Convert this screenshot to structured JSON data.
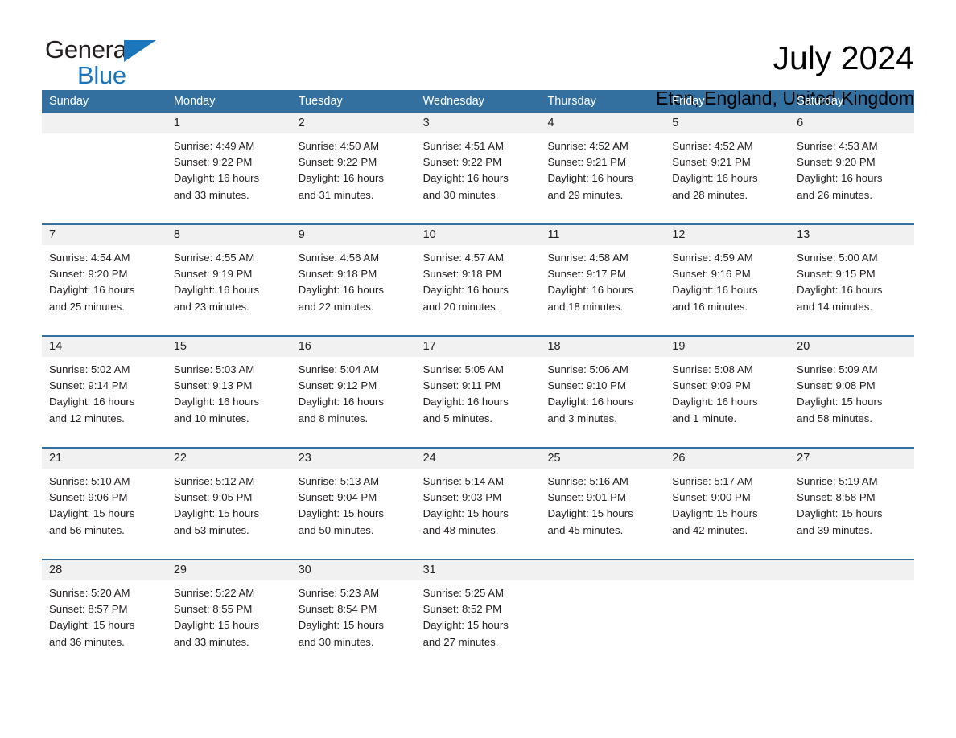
{
  "brand": {
    "name_part1": "General",
    "name_part2": "Blue",
    "color_primary": "#1b76bc",
    "triangle_icon": "triangle-icon"
  },
  "header": {
    "title": "July 2024",
    "subtitle": "Eton, England, United Kingdom"
  },
  "colors": {
    "header_row_bg": "#34709f",
    "date_band_bg": "#f1f1f1",
    "row_divider": "#34709f",
    "text": "#231f20",
    "brand_blue": "#1b76bc"
  },
  "calendar": {
    "day_names": [
      "Sunday",
      "Monday",
      "Tuesday",
      "Wednesday",
      "Thursday",
      "Friday",
      "Saturday"
    ],
    "weeks": [
      [
        {
          "day": "",
          "lines": []
        },
        {
          "day": "1",
          "lines": [
            "Sunrise: 4:49 AM",
            "Sunset: 9:22 PM",
            "Daylight: 16 hours",
            "and 33 minutes."
          ]
        },
        {
          "day": "2",
          "lines": [
            "Sunrise: 4:50 AM",
            "Sunset: 9:22 PM",
            "Daylight: 16 hours",
            "and 31 minutes."
          ]
        },
        {
          "day": "3",
          "lines": [
            "Sunrise: 4:51 AM",
            "Sunset: 9:22 PM",
            "Daylight: 16 hours",
            "and 30 minutes."
          ]
        },
        {
          "day": "4",
          "lines": [
            "Sunrise: 4:52 AM",
            "Sunset: 9:21 PM",
            "Daylight: 16 hours",
            "and 29 minutes."
          ]
        },
        {
          "day": "5",
          "lines": [
            "Sunrise: 4:52 AM",
            "Sunset: 9:21 PM",
            "Daylight: 16 hours",
            "and 28 minutes."
          ]
        },
        {
          "day": "6",
          "lines": [
            "Sunrise: 4:53 AM",
            "Sunset: 9:20 PM",
            "Daylight: 16 hours",
            "and 26 minutes."
          ]
        }
      ],
      [
        {
          "day": "7",
          "lines": [
            "Sunrise: 4:54 AM",
            "Sunset: 9:20 PM",
            "Daylight: 16 hours",
            "and 25 minutes."
          ]
        },
        {
          "day": "8",
          "lines": [
            "Sunrise: 4:55 AM",
            "Sunset: 9:19 PM",
            "Daylight: 16 hours",
            "and 23 minutes."
          ]
        },
        {
          "day": "9",
          "lines": [
            "Sunrise: 4:56 AM",
            "Sunset: 9:18 PM",
            "Daylight: 16 hours",
            "and 22 minutes."
          ]
        },
        {
          "day": "10",
          "lines": [
            "Sunrise: 4:57 AM",
            "Sunset: 9:18 PM",
            "Daylight: 16 hours",
            "and 20 minutes."
          ]
        },
        {
          "day": "11",
          "lines": [
            "Sunrise: 4:58 AM",
            "Sunset: 9:17 PM",
            "Daylight: 16 hours",
            "and 18 minutes."
          ]
        },
        {
          "day": "12",
          "lines": [
            "Sunrise: 4:59 AM",
            "Sunset: 9:16 PM",
            "Daylight: 16 hours",
            "and 16 minutes."
          ]
        },
        {
          "day": "13",
          "lines": [
            "Sunrise: 5:00 AM",
            "Sunset: 9:15 PM",
            "Daylight: 16 hours",
            "and 14 minutes."
          ]
        }
      ],
      [
        {
          "day": "14",
          "lines": [
            "Sunrise: 5:02 AM",
            "Sunset: 9:14 PM",
            "Daylight: 16 hours",
            "and 12 minutes."
          ]
        },
        {
          "day": "15",
          "lines": [
            "Sunrise: 5:03 AM",
            "Sunset: 9:13 PM",
            "Daylight: 16 hours",
            "and 10 minutes."
          ]
        },
        {
          "day": "16",
          "lines": [
            "Sunrise: 5:04 AM",
            "Sunset: 9:12 PM",
            "Daylight: 16 hours",
            "and 8 minutes."
          ]
        },
        {
          "day": "17",
          "lines": [
            "Sunrise: 5:05 AM",
            "Sunset: 9:11 PM",
            "Daylight: 16 hours",
            "and 5 minutes."
          ]
        },
        {
          "day": "18",
          "lines": [
            "Sunrise: 5:06 AM",
            "Sunset: 9:10 PM",
            "Daylight: 16 hours",
            "and 3 minutes."
          ]
        },
        {
          "day": "19",
          "lines": [
            "Sunrise: 5:08 AM",
            "Sunset: 9:09 PM",
            "Daylight: 16 hours",
            "and 1 minute."
          ]
        },
        {
          "day": "20",
          "lines": [
            "Sunrise: 5:09 AM",
            "Sunset: 9:08 PM",
            "Daylight: 15 hours",
            "and 58 minutes."
          ]
        }
      ],
      [
        {
          "day": "21",
          "lines": [
            "Sunrise: 5:10 AM",
            "Sunset: 9:06 PM",
            "Daylight: 15 hours",
            "and 56 minutes."
          ]
        },
        {
          "day": "22",
          "lines": [
            "Sunrise: 5:12 AM",
            "Sunset: 9:05 PM",
            "Daylight: 15 hours",
            "and 53 minutes."
          ]
        },
        {
          "day": "23",
          "lines": [
            "Sunrise: 5:13 AM",
            "Sunset: 9:04 PM",
            "Daylight: 15 hours",
            "and 50 minutes."
          ]
        },
        {
          "day": "24",
          "lines": [
            "Sunrise: 5:14 AM",
            "Sunset: 9:03 PM",
            "Daylight: 15 hours",
            "and 48 minutes."
          ]
        },
        {
          "day": "25",
          "lines": [
            "Sunrise: 5:16 AM",
            "Sunset: 9:01 PM",
            "Daylight: 15 hours",
            "and 45 minutes."
          ]
        },
        {
          "day": "26",
          "lines": [
            "Sunrise: 5:17 AM",
            "Sunset: 9:00 PM",
            "Daylight: 15 hours",
            "and 42 minutes."
          ]
        },
        {
          "day": "27",
          "lines": [
            "Sunrise: 5:19 AM",
            "Sunset: 8:58 PM",
            "Daylight: 15 hours",
            "and 39 minutes."
          ]
        }
      ],
      [
        {
          "day": "28",
          "lines": [
            "Sunrise: 5:20 AM",
            "Sunset: 8:57 PM",
            "Daylight: 15 hours",
            "and 36 minutes."
          ]
        },
        {
          "day": "29",
          "lines": [
            "Sunrise: 5:22 AM",
            "Sunset: 8:55 PM",
            "Daylight: 15 hours",
            "and 33 minutes."
          ]
        },
        {
          "day": "30",
          "lines": [
            "Sunrise: 5:23 AM",
            "Sunset: 8:54 PM",
            "Daylight: 15 hours",
            "and 30 minutes."
          ]
        },
        {
          "day": "31",
          "lines": [
            "Sunrise: 5:25 AM",
            "Sunset: 8:52 PM",
            "Daylight: 15 hours",
            "and 27 minutes."
          ]
        },
        {
          "day": "",
          "lines": []
        },
        {
          "day": "",
          "lines": []
        },
        {
          "day": "",
          "lines": []
        }
      ]
    ]
  }
}
